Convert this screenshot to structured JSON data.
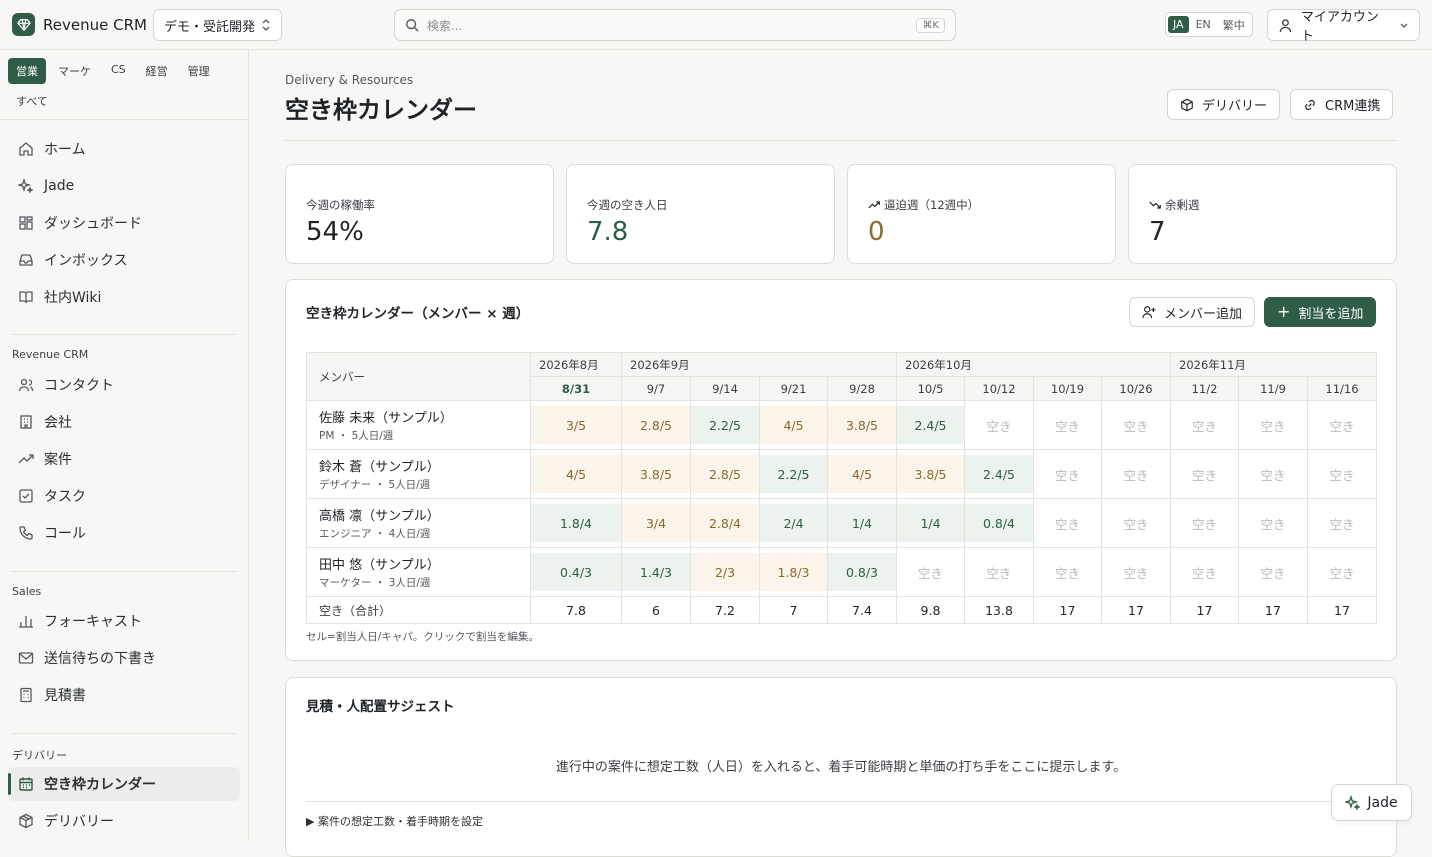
{
  "topbar": {
    "app_name": "Revenue CRM",
    "workspace": "デモ・受託開発",
    "search_placeholder": "検索...",
    "search_shortcut": "⌘K",
    "languages": [
      "JA",
      "EN",
      "繁中"
    ],
    "account": "マイアカウント"
  },
  "sidebar": {
    "role_tabs": [
      "営業",
      "マーケ",
      "CS",
      "経営",
      "管理",
      "すべて"
    ],
    "main_items": [
      "ホーム",
      "Jade",
      "ダッシュボード",
      "インボックス",
      "社内Wiki"
    ],
    "section_crm": "Revenue CRM",
    "crm_items": [
      "コンタクト",
      "会社",
      "案件",
      "タスク",
      "コール"
    ],
    "section_sales": "Sales",
    "sales_items": [
      "フォーキャスト",
      "送信待ちの下書き",
      "見積書"
    ],
    "section_delivery": "デリバリー",
    "delivery_items": [
      "空き枠カレンダー",
      "デリバリー"
    ]
  },
  "header": {
    "eyebrow": "Delivery & Resources",
    "title": "空き枠カレンダー",
    "delivery_button": "デリバリー",
    "crm_button": "CRM連携"
  },
  "stats": [
    {
      "label": "今週の稼働率",
      "value": "54%",
      "color": "#1f2328"
    },
    {
      "label": "今週の空き人日",
      "value": "7.8",
      "color": "#2f5d46"
    },
    {
      "label": "逼迫週（12週中）",
      "value": "0",
      "color": "#8a6a2e"
    },
    {
      "label": "余剰週",
      "value": "7",
      "color": "#1f2328"
    }
  ],
  "calendar": {
    "title": "空き枠カレンダー（メンバー × 週）",
    "add_member": "メンバー追加",
    "add_assignment": "割当を追加",
    "member_header": "メンバー",
    "months": [
      {
        "label": "2026年8月",
        "span": 1
      },
      {
        "label": "2026年9月",
        "span": 4
      },
      {
        "label": "2026年10月",
        "span": 4
      },
      {
        "label": "2026年11月",
        "span": 3
      }
    ],
    "weeks": [
      "8/31",
      "9/7",
      "9/14",
      "9/21",
      "9/28",
      "10/5",
      "10/12",
      "10/19",
      "10/26",
      "11/2",
      "11/9",
      "11/16"
    ],
    "members": [
      {
        "name": "佐藤 未来（サンプル）",
        "meta": "PM ・ 5人日/週",
        "cells": [
          "3/5",
          "2.8/5",
          "2.2/5",
          "4/5",
          "3.8/5",
          "2.4/5",
          "空き",
          "空き",
          "空き",
          "空き",
          "空き",
          "空き"
        ],
        "kinds": [
          "busy",
          "busy",
          "ok",
          "busy",
          "busy",
          "ok",
          "free",
          "free",
          "free",
          "free",
          "free",
          "free"
        ]
      },
      {
        "name": "鈴木 蒼（サンプル）",
        "meta": "デザイナー ・ 5人日/週",
        "cells": [
          "4/5",
          "3.8/5",
          "2.8/5",
          "2.2/5",
          "4/5",
          "3.8/5",
          "2.4/5",
          "空き",
          "空き",
          "空き",
          "空き",
          "空き"
        ],
        "kinds": [
          "busy",
          "busy",
          "busy",
          "ok",
          "busy",
          "busy",
          "ok",
          "free",
          "free",
          "free",
          "free",
          "free"
        ]
      },
      {
        "name": "高橋 凛（サンプル）",
        "meta": "エンジニア ・ 4人日/週",
        "cells": [
          "1.8/4",
          "3/4",
          "2.8/4",
          "2/4",
          "1/4",
          "1/4",
          "0.8/4",
          "空き",
          "空き",
          "空き",
          "空き",
          "空き"
        ],
        "kinds": [
          "ok",
          "busy",
          "busy",
          "ok",
          "ok",
          "ok",
          "ok",
          "free",
          "free",
          "free",
          "free",
          "free"
        ]
      },
      {
        "name": "田中 悠（サンプル）",
        "meta": "マーケター ・ 3人日/週",
        "cells": [
          "0.4/3",
          "1.4/3",
          "2/3",
          "1.8/3",
          "0.8/3",
          "空き",
          "空き",
          "空き",
          "空き",
          "空き",
          "空き",
          "空き"
        ],
        "kinds": [
          "ok",
          "ok",
          "busy",
          "busy",
          "ok",
          "free",
          "free",
          "free",
          "free",
          "free",
          "free",
          "free"
        ]
      }
    ],
    "total_label": "空き（合計）",
    "totals": [
      "7.8",
      "6",
      "7.2",
      "7",
      "7.4",
      "9.8",
      "13.8",
      "17",
      "17",
      "17",
      "17",
      "17"
    ],
    "note": "セル=割当人日/キャパ。クリックで割当を編集。"
  },
  "suggest": {
    "title": "見積・人配置サジェスト",
    "message": "進行中の案件に想定工数（人日）を入れると、着手可能時期と単価の打ち手をここに提示します。",
    "toggle": "▶ 案件の想定工数・着手時期を設定"
  },
  "fab": {
    "label": "Jade"
  }
}
